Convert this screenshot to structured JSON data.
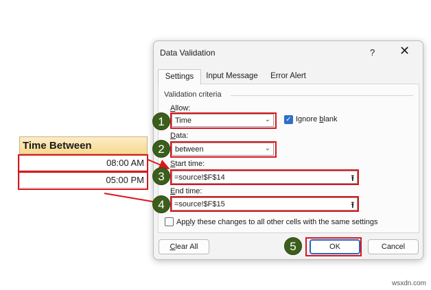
{
  "sheet": {
    "header": "Time Between",
    "cells": [
      "08:00 AM",
      "05:00 PM"
    ]
  },
  "dialog": {
    "title": "Data Validation",
    "help_label": "?",
    "close_label": "✕",
    "tabs": [
      {
        "label": "Settings",
        "active": true
      },
      {
        "label": "Input Message",
        "active": false
      },
      {
        "label": "Error Alert",
        "active": false
      }
    ],
    "group_label": "Validation criteria",
    "allow": {
      "label_u": "A",
      "label_rest": "llow:",
      "value": "Time"
    },
    "ignore_blank": {
      "label_pre": "Ignore ",
      "label_u": "b",
      "label_rest": "lank",
      "checked": true
    },
    "data": {
      "label_u": "D",
      "label_rest": "ata:",
      "value": "between"
    },
    "start_time": {
      "label_u": "S",
      "label_rest": "tart time:",
      "value": "=source!$F$14"
    },
    "end_time": {
      "label_u": "E",
      "label_rest": "nd time:",
      "value": "=source!$F$15"
    },
    "apply_all": {
      "label_pre": "Ap",
      "label_u": "p",
      "label_rest": "ly these changes to all other cells with the same settings",
      "checked": false
    },
    "buttons": {
      "clear_u": "C",
      "clear_rest": "lear All",
      "ok": "OK",
      "cancel": "Cancel"
    }
  },
  "badges": [
    "1",
    "2",
    "3",
    "4",
    "5"
  ],
  "watermark": "wsxdn.com",
  "colors": {
    "highlight": "#d9161c",
    "badge": "#3c5e1c",
    "accent": "#2f6fcb"
  }
}
